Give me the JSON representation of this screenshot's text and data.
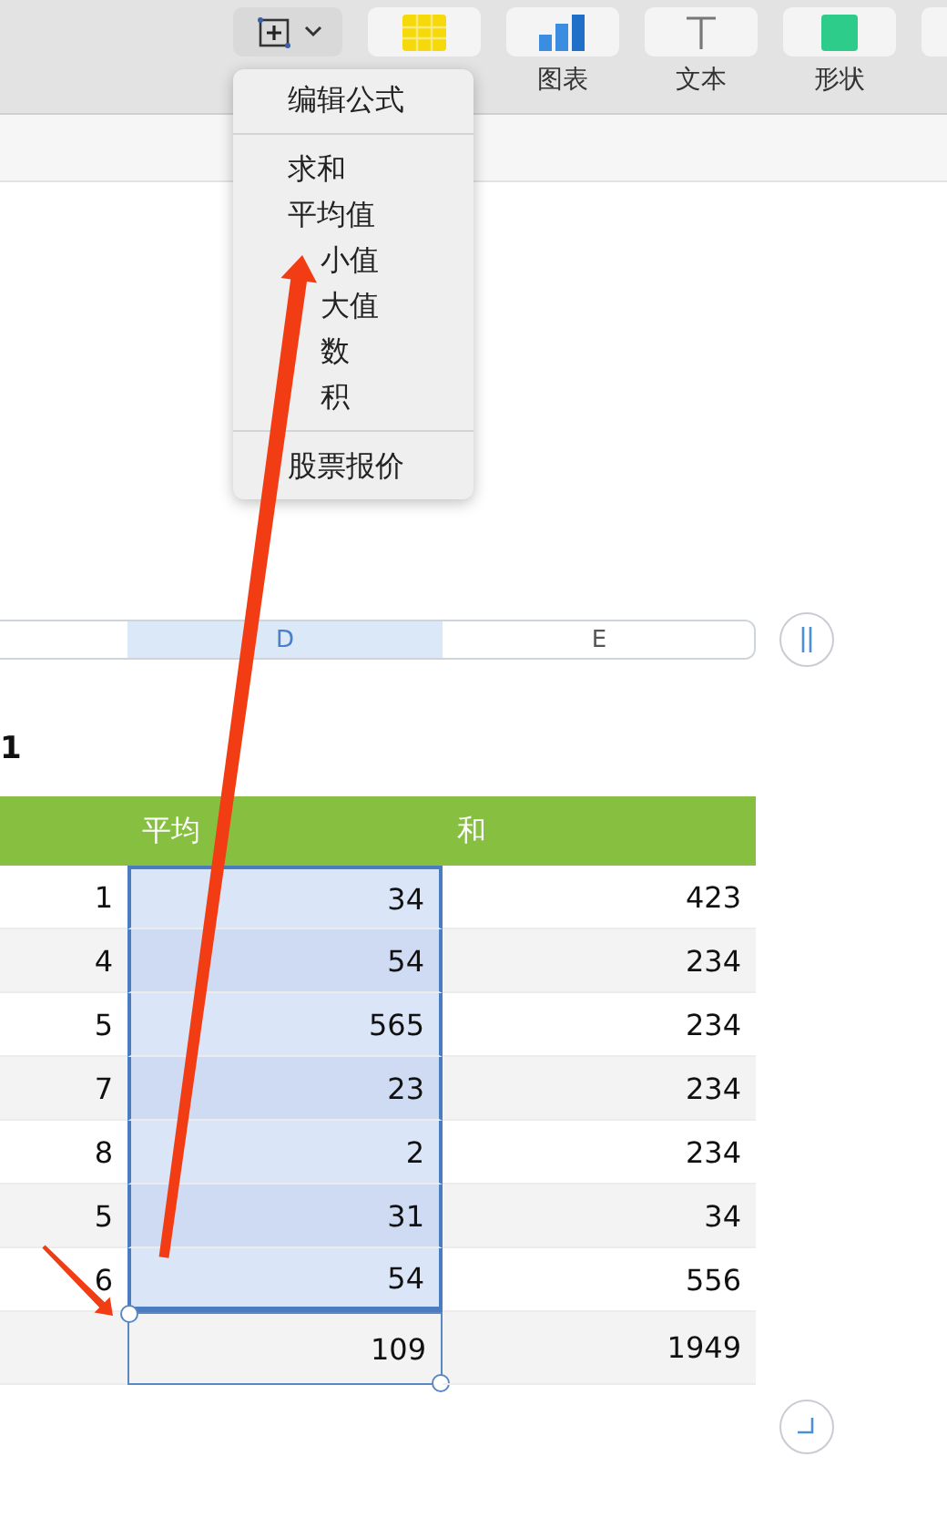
{
  "toolbar": {
    "buttons": [
      {
        "kind": "function"
      },
      {
        "kind": "table"
      },
      {
        "kind": "chart",
        "label": "图表"
      },
      {
        "kind": "text",
        "label": "文本"
      },
      {
        "kind": "shape",
        "label": "形状"
      },
      {
        "kind": "more"
      }
    ]
  },
  "function_menu": {
    "groups": [
      [
        {
          "label": "编辑公式",
          "kind": "item"
        }
      ],
      [
        {
          "label": "求和",
          "kind": "item"
        },
        {
          "label": "平均值",
          "kind": "item"
        },
        {
          "label": "小值",
          "kind": "partly_hidden"
        },
        {
          "label": "大值",
          "kind": "partly_hidden"
        },
        {
          "label": "数",
          "kind": "partly_hidden"
        },
        {
          "label": "积",
          "kind": "partly_hidden"
        }
      ],
      [
        {
          "label": "股票报价",
          "kind": "item"
        }
      ]
    ]
  },
  "column_bar": [
    {
      "selected": false
    },
    {
      "label": "D",
      "selected": true
    },
    {
      "label": "E",
      "selected": false
    }
  ],
  "table": {
    "title": "1",
    "columns": [
      {
        "selected": false
      },
      {
        "header": "平均",
        "selected": true
      },
      {
        "header": "和",
        "selected": false
      }
    ],
    "rows": [
      [
        "1",
        "34",
        "423"
      ],
      [
        "4",
        "54",
        "234"
      ],
      [
        "5",
        "565",
        "234"
      ],
      [
        "7",
        "23",
        "234"
      ],
      [
        "8",
        "2",
        "234"
      ],
      [
        "5",
        "31",
        "34"
      ],
      [
        "6",
        "54",
        "556"
      ]
    ],
    "footer": [
      {
        "text": "109",
        "selected": true
      },
      {
        "text": "1949",
        "selected": false
      }
    ]
  },
  "annotations": [
    {
      "kind": "arrow"
    },
    {
      "kind": "arrow"
    }
  ]
}
